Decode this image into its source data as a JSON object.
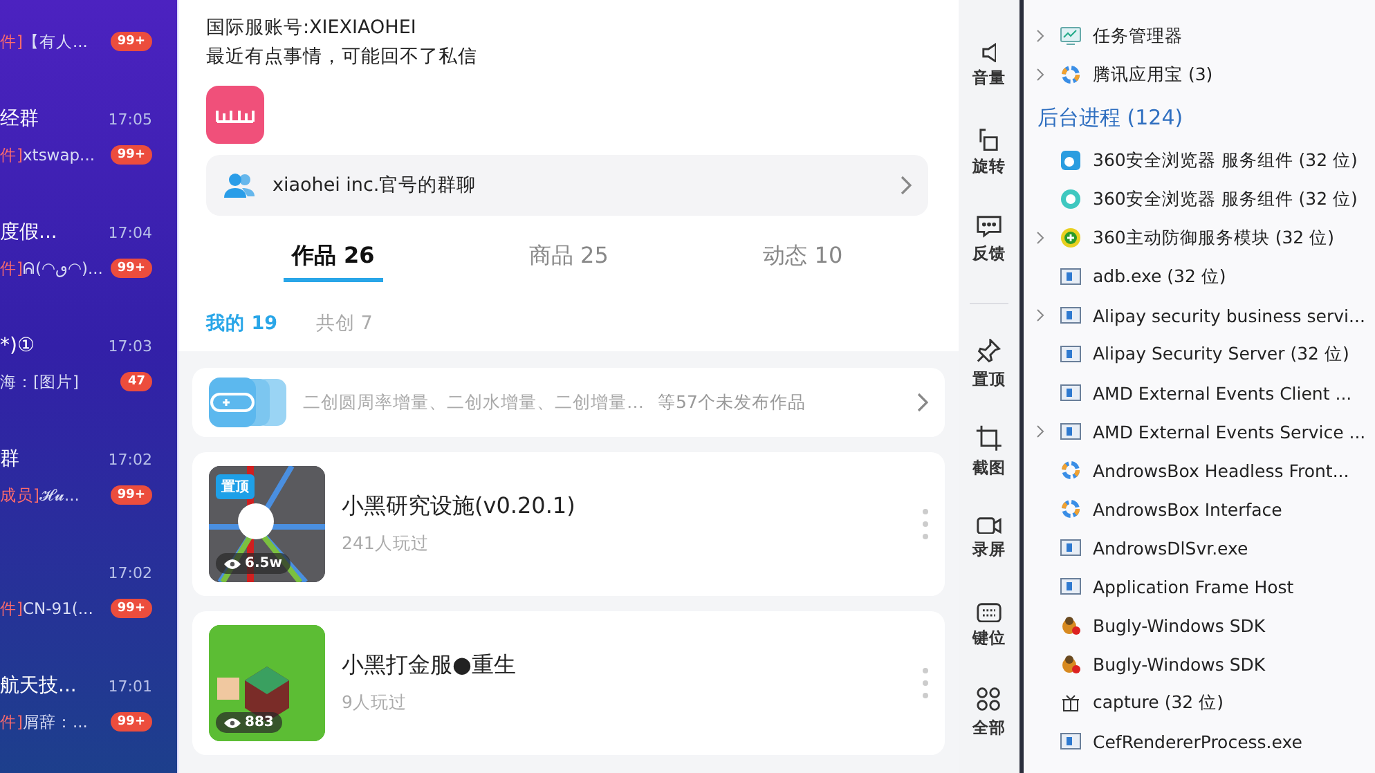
{
  "chat_list": [
    {
      "preview_tag": "件]",
      "preview": "【有人...",
      "badge": "99+"
    },
    {
      "title": "经群",
      "time": "17:05",
      "preview_tag": "件]",
      "preview": "xtswap...",
      "badge": "99+"
    },
    {
      "title": "度假...",
      "time": "17:04",
      "preview_tag": "件]",
      "preview": "ᕱ(◠ٯ◠)...",
      "badge": "99+"
    },
    {
      "title": "*)①",
      "time": "17:03",
      "preview": "海：[图片]",
      "badge": "47"
    },
    {
      "title": "群",
      "time": "17:02",
      "preview_tag": "成员]",
      "preview": "𝓗𝓾...",
      "badge": "99+"
    },
    {
      "time": "17:02",
      "preview_tag": "件]",
      "preview": "CN-91(...",
      "badge": "99+"
    },
    {
      "title": "航天技...",
      "time": "17:01",
      "preview_tag": "件]",
      "preview": "屑辞：...",
      "badge": "99+"
    }
  ],
  "profile": {
    "bio": [
      "国际服账号:XIEXIAOHEI",
      "最近有点事情，可能回不了私信"
    ],
    "group_chat": "xiaohei inc.官号的群聊",
    "tabs": [
      {
        "label": "作品 26",
        "selected": true
      },
      {
        "label": "商品 25",
        "selected": false
      },
      {
        "label": "动态 10",
        "selected": false
      }
    ],
    "subtabs": [
      {
        "label": "我的 19",
        "selected": true
      },
      {
        "label": "共创 7",
        "selected": false
      }
    ],
    "drafts": {
      "text": "二创圆周率增量、二创水增量、二创增量…",
      "count": "等57个未发布作品"
    },
    "works": [
      {
        "kind": "map",
        "badge": "置顶",
        "views": "6.5w",
        "title": "小黑研究设施(v0.20.1)",
        "plays": "241人玩过"
      },
      {
        "kind": "block",
        "views": "883",
        "title": "小黑打金服●重生",
        "plays": "9人玩过"
      }
    ]
  },
  "emulator_toolbar": {
    "groups": [
      {
        "items": [
          {
            "kind": "volume",
            "label": "音量"
          },
          {
            "kind": "rotate",
            "label": "旋转"
          },
          {
            "kind": "feedback",
            "label": "反馈"
          }
        ]
      },
      {
        "items": [
          {
            "kind": "pin",
            "label": "置顶"
          },
          {
            "kind": "crop",
            "label": "截图"
          },
          {
            "kind": "record",
            "label": "录屏"
          },
          {
            "kind": "keyboard",
            "label": "键位"
          },
          {
            "kind": "grid",
            "label": "全部"
          }
        ]
      }
    ]
  },
  "task_manager": {
    "apps": [
      {
        "kind": "taskmgr",
        "name": "任务管理器",
        "expandable": true
      },
      {
        "kind": "wheel",
        "name": "腾讯应用宝 (3)",
        "expandable": true
      }
    ],
    "background_heading": "后台进程 (124)",
    "background": [
      {
        "kind": "browser",
        "name": "360安全浏览器 服务组件 (32 位)",
        "expandable": false
      },
      {
        "kind": "circle",
        "name": "360安全浏览器 服务组件 (32 位)",
        "expandable": false
      },
      {
        "kind": "plus",
        "name": "360主动防御服务模块 (32 位)",
        "expandable": true
      },
      {
        "kind": "window",
        "name": "adb.exe (32 位)",
        "expandable": false
      },
      {
        "kind": "window",
        "name": "Alipay security business servi...",
        "expandable": true
      },
      {
        "kind": "window",
        "name": "Alipay Security Server (32 位)",
        "expandable": false
      },
      {
        "kind": "window",
        "name": "AMD External Events Client ...",
        "expandable": false
      },
      {
        "kind": "window",
        "name": "AMD External Events Service ...",
        "expandable": true
      },
      {
        "kind": "wheel",
        "name": "AndrowsBox Headless Front...",
        "expandable": false
      },
      {
        "kind": "wheel",
        "name": "AndrowsBox Interface",
        "expandable": false
      },
      {
        "kind": "window",
        "name": "AndrowsDlSvr.exe",
        "expandable": false
      },
      {
        "kind": "window",
        "name": "Application Frame Host",
        "expandable": false
      },
      {
        "kind": "bug",
        "name": "Bugly-Windows SDK",
        "expandable": false
      },
      {
        "kind": "bug",
        "name": "Bugly-Windows SDK",
        "expandable": false
      },
      {
        "kind": "gift",
        "name": "capture (32 位)",
        "expandable": false
      },
      {
        "kind": "window",
        "name": "CefRendererProcess.exe",
        "expandable": false
      }
    ]
  }
}
